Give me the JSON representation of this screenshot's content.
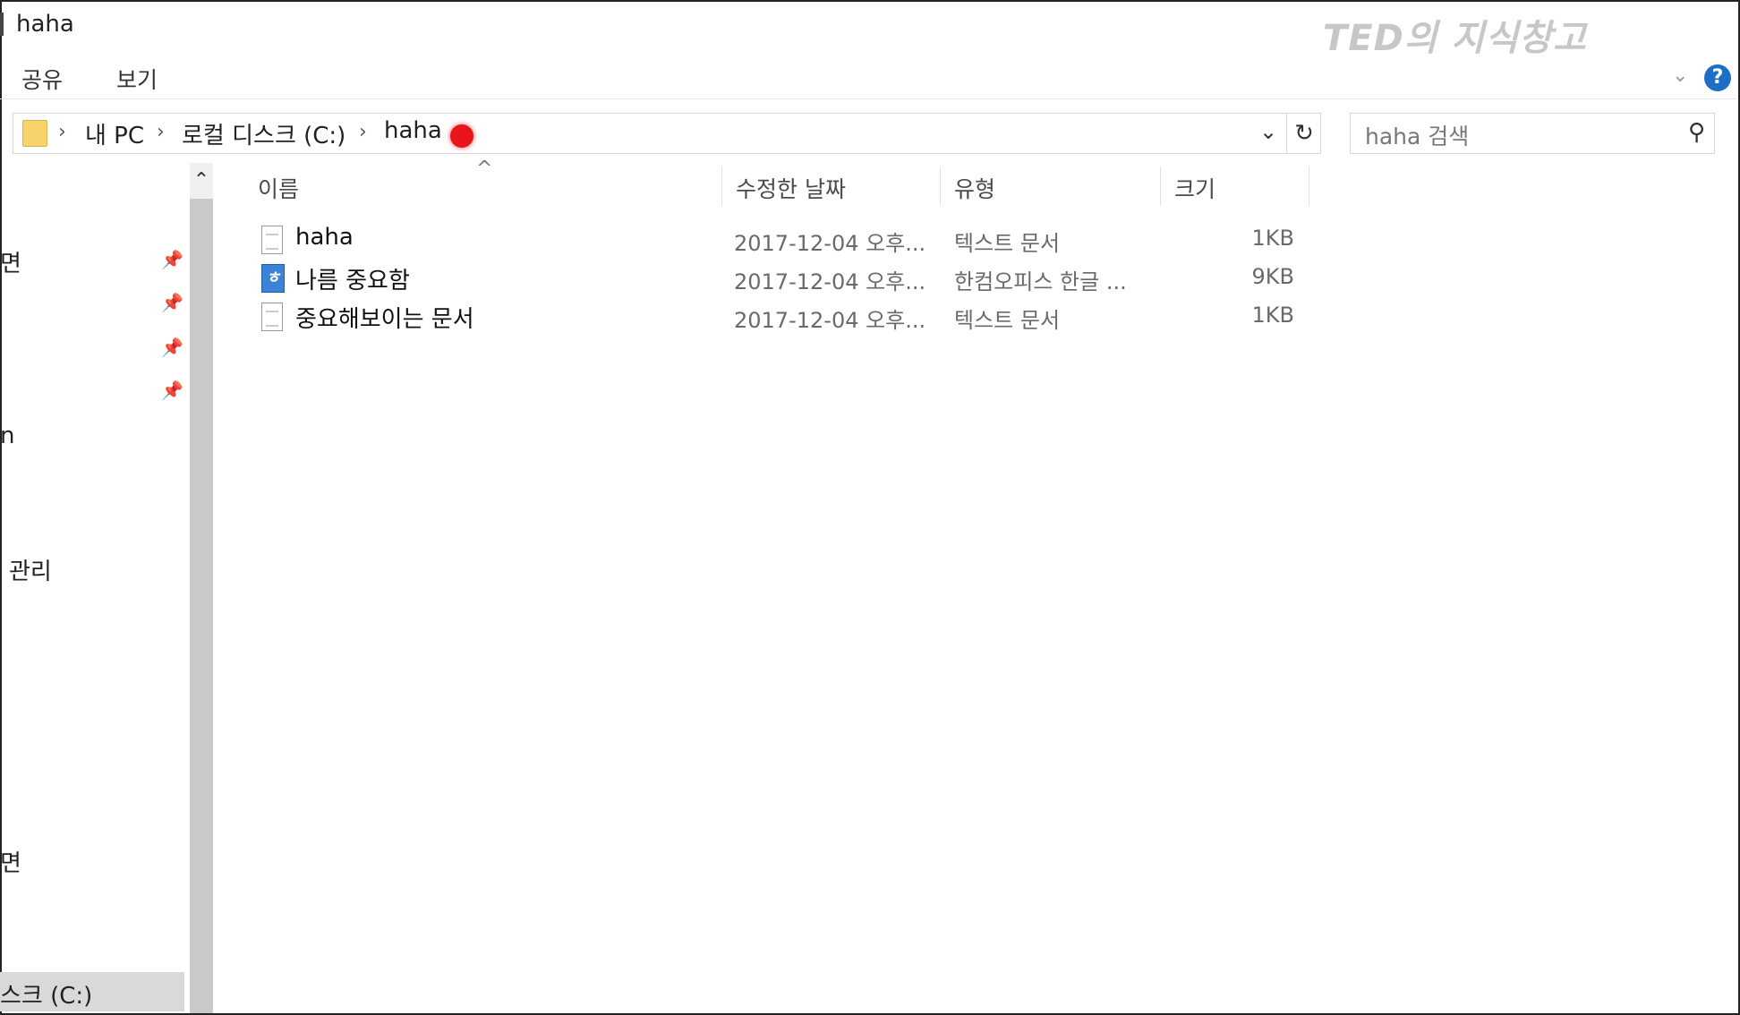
{
  "window": {
    "title": "haha",
    "watermark": "TED의 지식창고"
  },
  "ribbon": {
    "tabs": [
      "공유",
      "보기"
    ]
  },
  "address": {
    "crumbs": [
      "내 PC",
      "로컬 디스크 (C:)",
      "haha"
    ]
  },
  "search": {
    "placeholder": "haha 검색"
  },
  "nav": {
    "partial_labels": [
      "면",
      "n",
      "관리",
      "면",
      "스크 (C:)"
    ]
  },
  "columns": {
    "name": "이름",
    "date": "수정한 날짜",
    "type": "유형",
    "size": "크기"
  },
  "files": [
    {
      "name": "haha",
      "date": "2017-12-04 오후...",
      "type": "텍스트 문서",
      "size": "1KB",
      "icon": "text-file-icon"
    },
    {
      "name": "나름 중요함",
      "date": "2017-12-04 오후...",
      "type": "한컴오피스 한글 ...",
      "size": "9KB",
      "icon": "hwp-file-icon"
    },
    {
      "name": "중요해보이는 문서",
      "date": "2017-12-04 오후...",
      "type": "텍스트 문서",
      "size": "1KB",
      "icon": "text-file-icon"
    }
  ],
  "colors": {
    "accent": "#1c6fc4",
    "folder": "#f6d46b",
    "marker": "#e8161b"
  }
}
